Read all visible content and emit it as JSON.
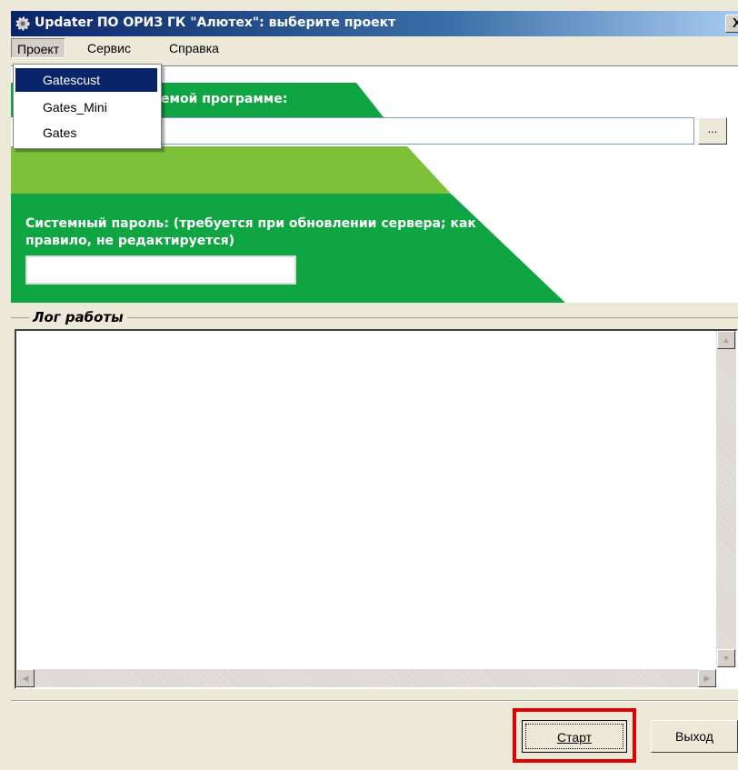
{
  "window": {
    "title": "Updater ПО ОРИЗ ГК \"Алютех\": выберите проект",
    "close_label": "X"
  },
  "menu": {
    "items": [
      {
        "label": "Проект"
      },
      {
        "label": "Сервис"
      },
      {
        "label": "Справка"
      }
    ],
    "dropdown": [
      "Gatescust",
      "Gates_Mini",
      "Gates"
    ]
  },
  "form": {
    "path_label": "емой программе:",
    "path_value": "",
    "browse_label": "...",
    "password_label": "Системный пароль: (требуется при обновлении сервера; как правило, не редактируется)",
    "password_value": ""
  },
  "log": {
    "title": "Лог работы",
    "content": ""
  },
  "buttons": {
    "start": "Старт",
    "exit": "Выход"
  },
  "colors": {
    "green_dark": "#0fa542",
    "green_light": "#7dc13a",
    "title_blue": "#0a246a",
    "highlight_red": "#e10000"
  }
}
